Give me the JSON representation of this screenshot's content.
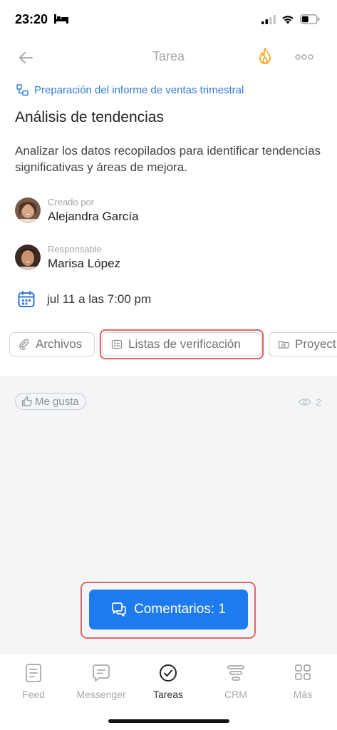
{
  "status": {
    "time": "23:20"
  },
  "nav": {
    "title": "Tarea"
  },
  "task": {
    "project": "Preparación del informe de ventas trimestral",
    "title": "Análisis de tendencias",
    "description": "Analizar los datos recopilados para identificar tendencias significativas y áreas de mejora."
  },
  "people": {
    "creator": {
      "role": "Creado por",
      "name": "Alejandra García"
    },
    "responsible": {
      "role": "Responsable",
      "name": "Marisa López"
    }
  },
  "deadline": "jul 11 a las 7:00 pm",
  "chips": [
    {
      "label": "Archivos",
      "icon": "paperclip-icon"
    },
    {
      "label": "Listas de verificación",
      "icon": "checklist-icon"
    },
    {
      "label": "Proyect",
      "icon": "folder-icon"
    }
  ],
  "activity": {
    "like_label": "Me gusta",
    "views_count": "2"
  },
  "comments_button": "Comentarios: 1",
  "tabbar": [
    {
      "label": "Feed",
      "icon": "feed-icon"
    },
    {
      "label": "Messenger",
      "icon": "messenger-icon"
    },
    {
      "label": "Tareas",
      "icon": "tasks-icon"
    },
    {
      "label": "CRM",
      "icon": "crm-icon"
    },
    {
      "label": "Más",
      "icon": "grid-icon"
    }
  ],
  "colors": {
    "accent": "#1e7bef",
    "link": "#2f7ad9",
    "highlight": "#d96a6a",
    "fire": "#f5a623"
  }
}
